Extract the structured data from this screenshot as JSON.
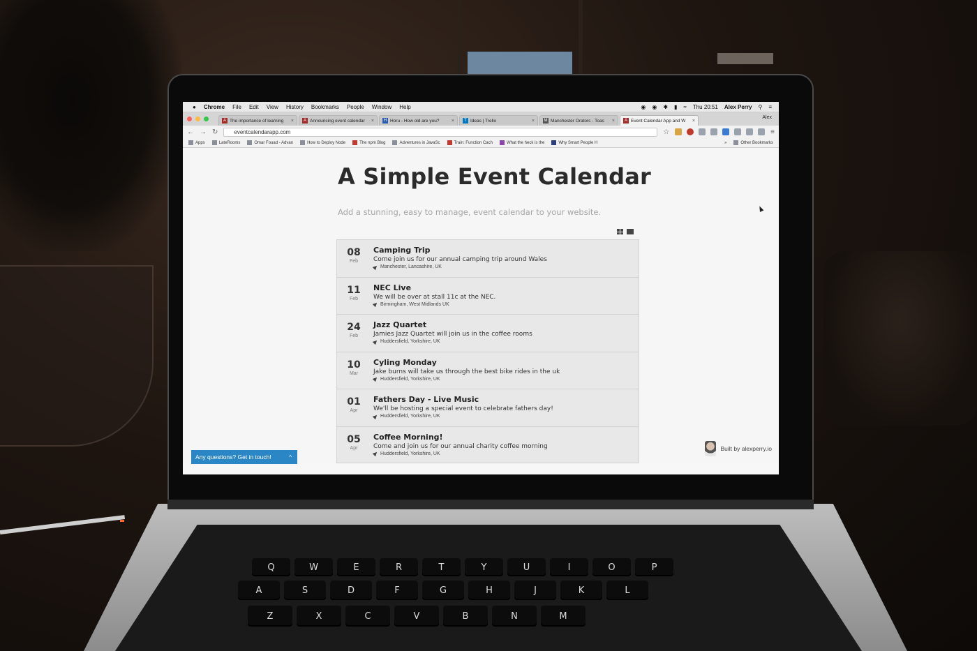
{
  "menubar": {
    "app": "Chrome",
    "items": [
      "File",
      "Edit",
      "View",
      "History",
      "Bookmarks",
      "People",
      "Window",
      "Help"
    ],
    "clock": "Thu 20:51",
    "user": "Alex Perry"
  },
  "tabs": [
    {
      "icon": "A",
      "title": "The importance of learning"
    },
    {
      "icon": "A",
      "title": "Announcing event calendar"
    },
    {
      "icon": "H",
      "title": "Horu - How old are you?"
    },
    {
      "icon": "T",
      "title": "Ideas | Trello"
    },
    {
      "icon": "M",
      "title": "Manchester Orators - Toas"
    },
    {
      "icon": "A",
      "title": "Event Calendar App and W"
    }
  ],
  "profile_name": "Alex",
  "url": "eventcalendarapp.com",
  "bookmarks": [
    "Apps",
    "LateRooms",
    "Omar Fouad - Advan",
    "How to Deploy Node",
    "The npm Blog",
    "Adventures in JavaSc",
    "Train: Function Cach",
    "What the heck is the",
    "Why Smart People H"
  ],
  "bookmarks_overflow": "»",
  "other_bookmarks": "Other Bookmarks",
  "page": {
    "title": "A Simple Event Calendar",
    "subtitle": "Add a stunning, easy to manage, event calendar to your website."
  },
  "events": [
    {
      "day": "08",
      "month": "Feb",
      "title": "Camping Trip",
      "description": "Come join us for our annual camping trip around Wales",
      "location": "Manchester, Lancashire, UK"
    },
    {
      "day": "11",
      "month": "Feb",
      "title": "NEC Live",
      "description": "We will be over at stall 11c at the NEC.",
      "location": "Birmingham, West Midlands UK"
    },
    {
      "day": "24",
      "month": "Feb",
      "title": "Jazz Quartet",
      "description": "Jamies Jazz Quartet will join us in the coffee rooms",
      "location": "Huddersfield, Yorkshire, UK"
    },
    {
      "day": "10",
      "month": "Mar",
      "title": "Cyling Monday",
      "description": "Jake burns will take us through the best bike rides in the uk",
      "location": "Huddersfield, Yorkshire, UK"
    },
    {
      "day": "01",
      "month": "Apr",
      "title": "Fathers Day - Live Music",
      "description": "We'll be hosting a special event to celebrate fathers day!",
      "location": "Huddersfield, Yorkshire, UK"
    },
    {
      "day": "05",
      "month": "Apr",
      "title": "Coffee Morning!",
      "description": "Come and join us for our annual charity coffee morning",
      "location": "Huddersfield, Yorkshire, UK"
    }
  ],
  "help_bar": {
    "label": "Any questions? Get in touch!",
    "chevron": "^"
  },
  "built_by": "Built by alexperry.io",
  "keyboard": {
    "row1": [
      "Q",
      "W",
      "E",
      "R",
      "T",
      "Y",
      "U",
      "I",
      "O",
      "P"
    ],
    "row2": [
      "A",
      "S",
      "D",
      "F",
      "G",
      "H",
      "J",
      "K",
      "L"
    ],
    "row3": [
      "Z",
      "X",
      "C",
      "V",
      "B",
      "N",
      "M"
    ]
  },
  "colors": {
    "accent": "#2b86c5",
    "traffic_red": "#fc605c",
    "traffic_yellow": "#fdbc40",
    "traffic_green": "#34c84a"
  }
}
